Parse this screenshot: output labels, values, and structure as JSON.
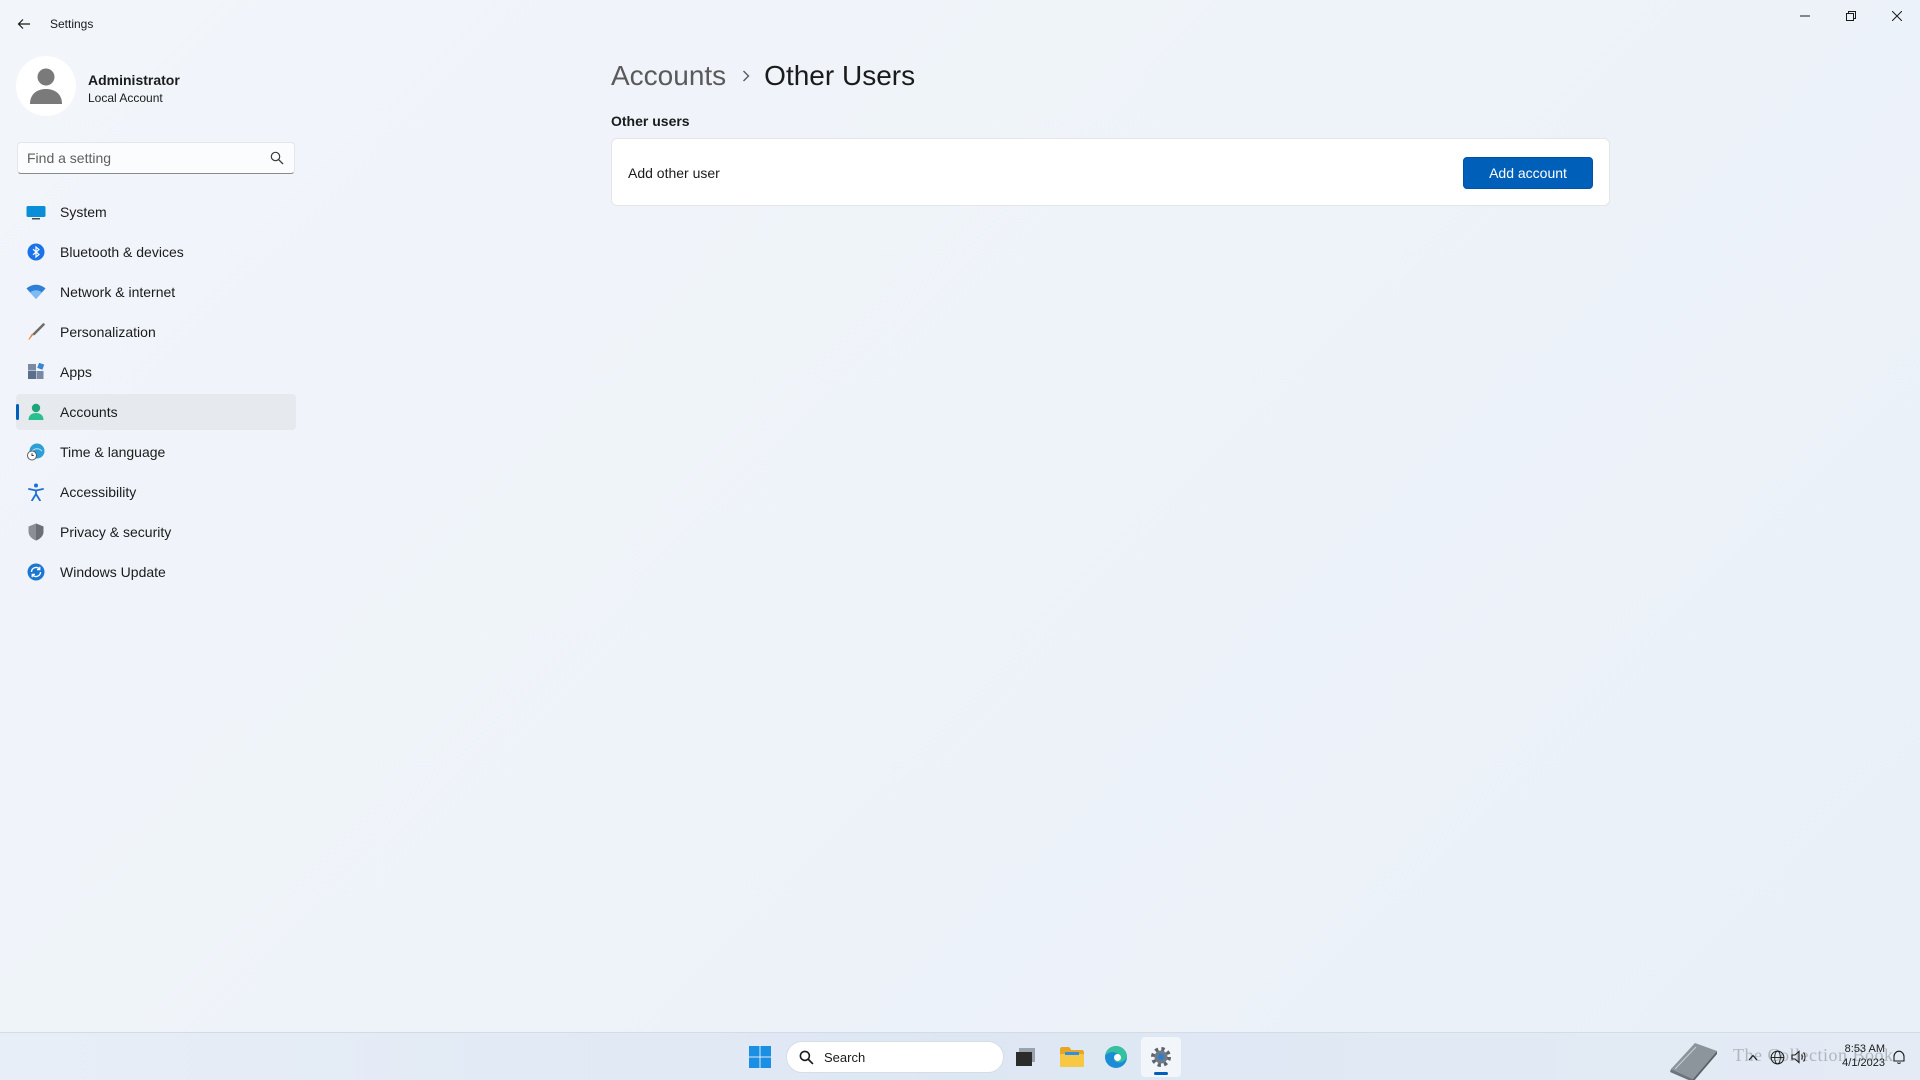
{
  "window": {
    "title": "Settings"
  },
  "profile": {
    "name": "Administrator",
    "account_type": "Local Account"
  },
  "search": {
    "placeholder": "Find a setting"
  },
  "nav": {
    "items": [
      {
        "label": "System",
        "icon": "monitor-icon",
        "active": false
      },
      {
        "label": "Bluetooth & devices",
        "icon": "bluetooth-icon",
        "active": false
      },
      {
        "label": "Network & internet",
        "icon": "wifi-icon",
        "active": false
      },
      {
        "label": "Personalization",
        "icon": "brush-icon",
        "active": false
      },
      {
        "label": "Apps",
        "icon": "apps-icon",
        "active": false
      },
      {
        "label": "Accounts",
        "icon": "person-icon",
        "active": true
      },
      {
        "label": "Time & language",
        "icon": "globe-clock-icon",
        "active": false
      },
      {
        "label": "Accessibility",
        "icon": "accessibility-icon",
        "active": false
      },
      {
        "label": "Privacy & security",
        "icon": "shield-icon",
        "active": false
      },
      {
        "label": "Windows Update",
        "icon": "update-icon",
        "active": false
      }
    ]
  },
  "content": {
    "breadcrumb_parent": "Accounts",
    "breadcrumb_current": "Other Users",
    "section_title": "Other users",
    "add_other_user_label": "Add other user",
    "add_account_button": "Add account"
  },
  "taskbar": {
    "search_label": "Search",
    "watermark": "The Collection Book",
    "time": "8:53 AM",
    "date": "4/1/2023"
  },
  "colors": {
    "accent": "#005fb8",
    "background": "#eef3f9"
  }
}
